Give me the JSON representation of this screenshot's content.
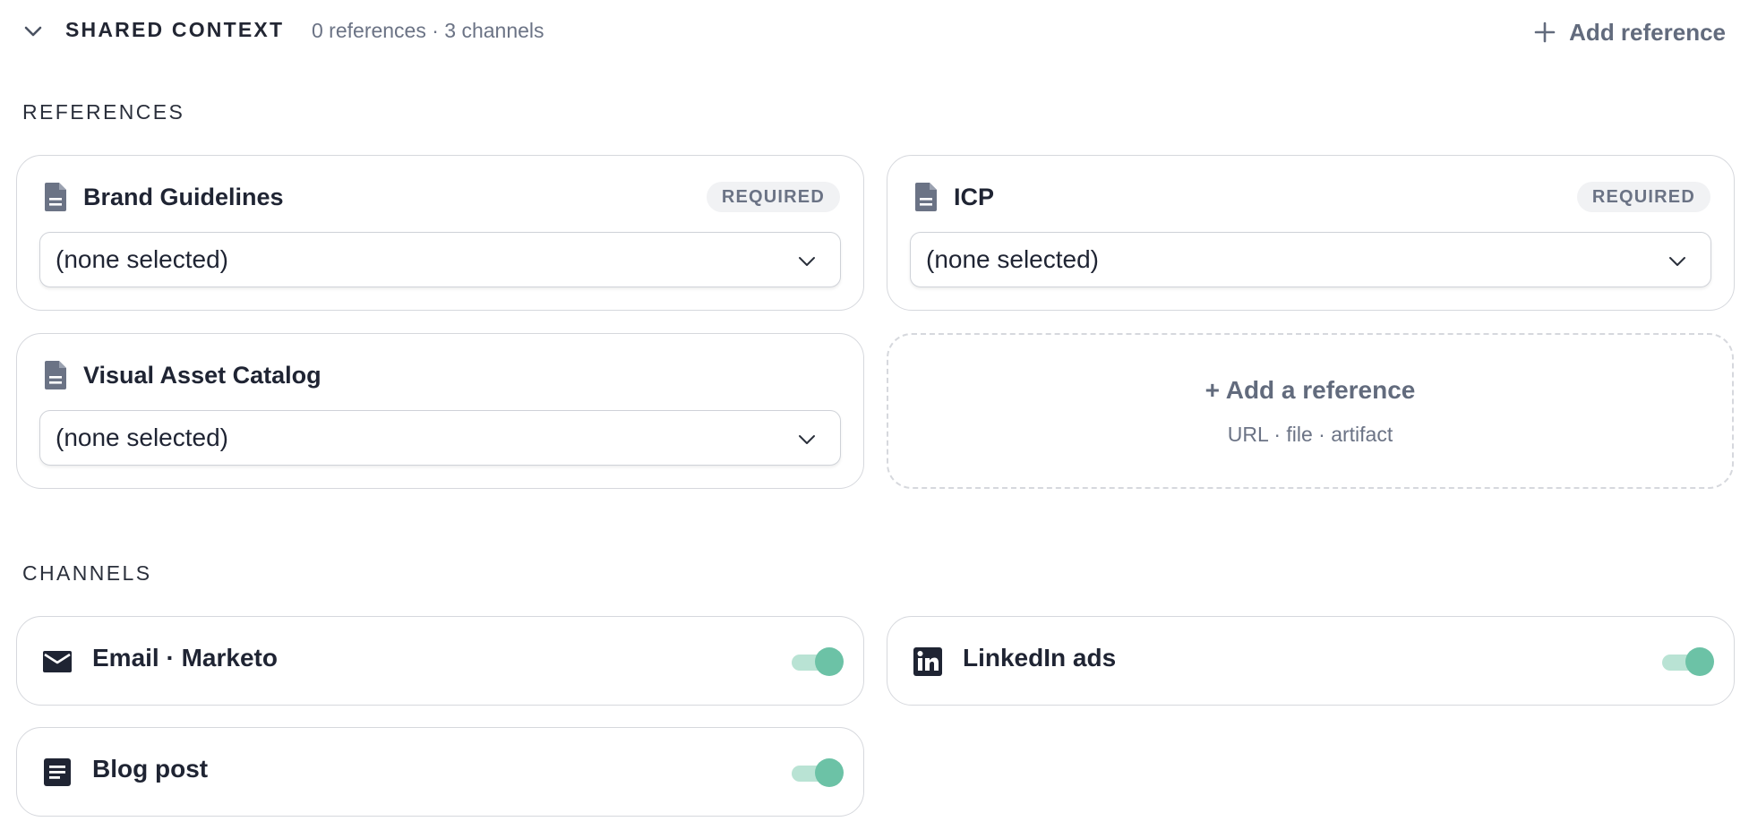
{
  "header": {
    "title": "SHARED CONTEXT",
    "summary": "0 references · 3 channels",
    "add_reference_label": "Add reference"
  },
  "references": {
    "section_label": "REFERENCES",
    "items": [
      {
        "name": "Brand Guidelines",
        "badge": "REQUIRED",
        "selected": "(none selected)"
      },
      {
        "name": "ICP",
        "badge": "REQUIRED",
        "selected": "(none selected)"
      },
      {
        "name": "Visual Asset Catalog",
        "badge": "",
        "selected": "(none selected)"
      }
    ],
    "add_card": {
      "title": "+ Add a reference",
      "subtitle": "URL · file · artifact"
    }
  },
  "channels": {
    "section_label": "CHANNELS",
    "items": [
      {
        "name": "Email · Marketo",
        "icon": "mail-icon",
        "enabled": true
      },
      {
        "name": "LinkedIn ads",
        "icon": "linkedin-icon",
        "enabled": true
      },
      {
        "name": "Blog post",
        "icon": "article-icon",
        "enabled": true
      }
    ]
  },
  "colors": {
    "toggle_on_track": "#b9e3d4",
    "toggle_on_knob": "#6cc2a6",
    "muted_text": "#6b7385",
    "border": "#d6d8dd"
  }
}
